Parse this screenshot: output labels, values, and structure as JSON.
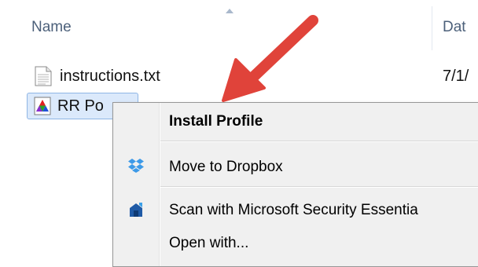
{
  "header": {
    "name_label": "Name",
    "date_label": "Dat"
  },
  "files": [
    {
      "name": "instructions.txt",
      "date": "7/1/",
      "icon": "text-file-icon"
    },
    {
      "name": "RR Po",
      "icon": "color-profile-icon"
    }
  ],
  "context_menu": {
    "items": [
      {
        "label": "Install Profile",
        "bold": true
      },
      {
        "label": "Move to Dropbox",
        "icon": "dropbox-icon"
      },
      {
        "label": "Scan with Microsoft Security Essentia",
        "icon": "security-essentials-icon"
      },
      {
        "label": "Open with..."
      }
    ]
  },
  "colors": {
    "annotation_arrow": "#e0433a",
    "selection_fill": "#dbe9fb",
    "selection_border": "#8fb6e5",
    "menu_background": "#f0f0f0"
  }
}
